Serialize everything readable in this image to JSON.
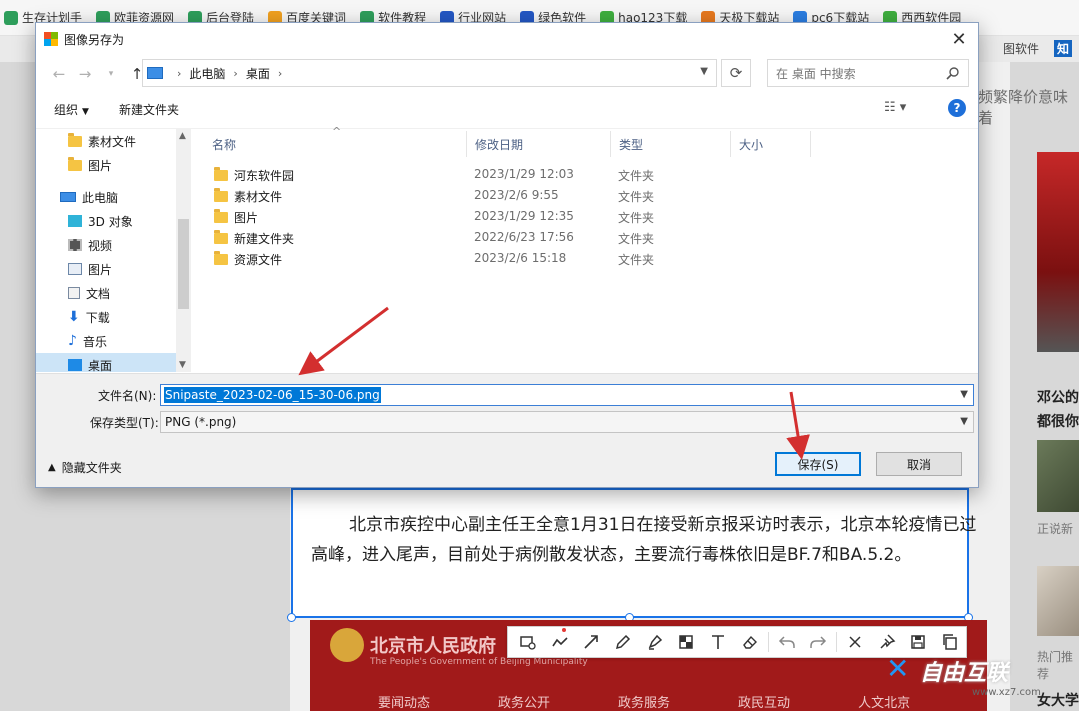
{
  "browser": {
    "bookmarks": [
      "生存计划手",
      "欧菲资源网",
      "后台登陆",
      "百度关键词",
      "软件教程",
      "行业网站",
      "绿色软件",
      "hao123下载",
      "天极下载站",
      "pc6下载站",
      "西西软件园"
    ],
    "bookmark_colors": [
      "#2e9e5b",
      "#2e9e5b",
      "#2e9e5b",
      "#f0a020",
      "#2e9e5b",
      "#2357c4",
      "#2357c4",
      "#3fae3f",
      "#e6781e",
      "#2a7de1",
      "#3fae3f"
    ],
    "tab_right_text": "图软件",
    "tab_right_badge": "知",
    "bg_heading": "频繁降价意味着"
  },
  "dialog": {
    "title": "图像另存为",
    "close_glyph": "✕",
    "nav": {
      "back": "←",
      "forward": "→",
      "up": "↑",
      "refresh": "⟳"
    },
    "breadcrumb": [
      "此电脑",
      "桌面"
    ],
    "search_placeholder": "在 桌面 中搜索",
    "toolbar": {
      "organize": "组织",
      "new_folder": "新建文件夹",
      "help": "?"
    },
    "nav_pane": [
      {
        "label": "素材文件",
        "icon": "folder-icon"
      },
      {
        "label": "图片",
        "icon": "folder-icon"
      },
      {
        "label": "此电脑",
        "icon": "computer-icon"
      },
      {
        "label": "3D 对象",
        "icon": "cube-3d-icon"
      },
      {
        "label": "视频",
        "icon": "video-icon"
      },
      {
        "label": "图片",
        "icon": "pictures-icon"
      },
      {
        "label": "文档",
        "icon": "document-icon"
      },
      {
        "label": "下载",
        "icon": "download-icon"
      },
      {
        "label": "音乐",
        "icon": "music-icon"
      },
      {
        "label": "桌面",
        "icon": "desktop-icon"
      }
    ],
    "columns": [
      "名称",
      "修改日期",
      "类型",
      "大小"
    ],
    "files": [
      {
        "name": "河东软件园",
        "date": "2023/1/29 12:03",
        "type": "文件夹"
      },
      {
        "name": "素材文件",
        "date": "2023/2/6 9:55",
        "type": "文件夹"
      },
      {
        "name": "图片",
        "date": "2023/1/29 12:35",
        "type": "文件夹"
      },
      {
        "name": "新建文件夹",
        "date": "2022/6/23 17:56",
        "type": "文件夹"
      },
      {
        "name": "资源文件",
        "date": "2023/2/6 15:18",
        "type": "文件夹"
      }
    ],
    "filename_label": "文件名(N):",
    "filename_value": "Snipaste_2023-02-06_15-30-06.png",
    "filetype_label": "保存类型(T):",
    "filetype_value": "PNG (*.png)",
    "hide_folders": "隐藏文件夹",
    "save_button": "保存(S)",
    "cancel_button": "取消"
  },
  "snip": {
    "text": "北京市疾控中心副主任王全意1月31日在接受新京报采访时表示，北京本轮疫情已过高峰，进入尾声，目前处于病例散发状态，主要流行毒株依旧是BF.7和BA.5.2。",
    "banner_title": "北京市人民政府",
    "banner_sub": "The People's Government of Beijing Municipality",
    "banner_nav": [
      "要闻动态",
      "政务公开",
      "政务服务",
      "政民互动",
      "人文北京"
    ],
    "tools": [
      "rectangle-icon",
      "pen-line-icon",
      "arrow-icon",
      "pencil-icon",
      "marker-icon",
      "mosaic-icon",
      "text-icon",
      "eraser-icon",
      "undo-icon",
      "redo-icon",
      "close-icon",
      "pin-icon",
      "save-icon",
      "copy-icon"
    ]
  },
  "sidebar_right": {
    "headline1": "邓公的",
    "headline2": "都很你",
    "caption1": "正说新",
    "caption2": "热门推荐",
    "headline3": "女大学"
  },
  "watermark": {
    "text": "自由互联",
    "url": "www.xz7.com"
  },
  "colors": {
    "accent": "#0078d7",
    "annotation_red": "#d32f2f",
    "banner_red": "#a11a1a"
  }
}
